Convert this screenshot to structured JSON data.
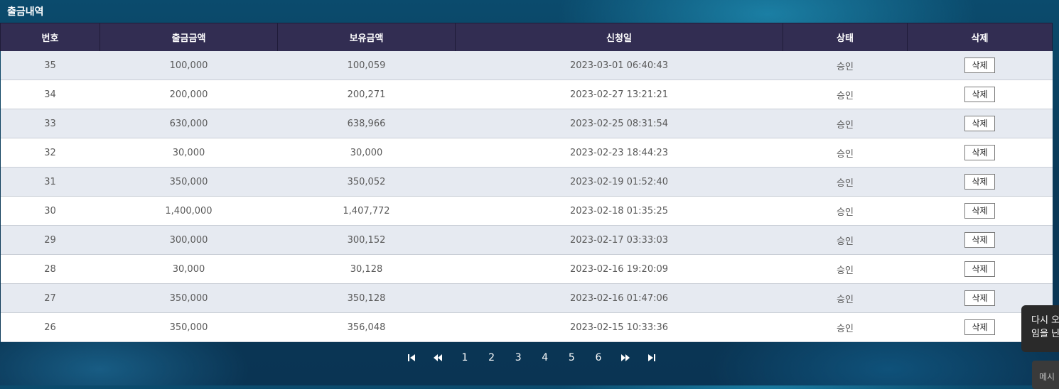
{
  "panel": {
    "title": "출금내역"
  },
  "table": {
    "headers": [
      "번호",
      "출금금액",
      "보유금액",
      "신청일",
      "상태",
      "삭제"
    ],
    "rows": [
      {
        "no": "35",
        "amount": "100,000",
        "balance": "100,059",
        "date": "2023-03-01 06:40:43",
        "status": "승인",
        "action": "삭제"
      },
      {
        "no": "34",
        "amount": "200,000",
        "balance": "200,271",
        "date": "2023-02-27 13:21:21",
        "status": "승인",
        "action": "삭제"
      },
      {
        "no": "33",
        "amount": "630,000",
        "balance": "638,966",
        "date": "2023-02-25 08:31:54",
        "status": "승인",
        "action": "삭제"
      },
      {
        "no": "32",
        "amount": "30,000",
        "balance": "30,000",
        "date": "2023-02-23 18:44:23",
        "status": "승인",
        "action": "삭제"
      },
      {
        "no": "31",
        "amount": "350,000",
        "balance": "350,052",
        "date": "2023-02-19 01:52:40",
        "status": "승인",
        "action": "삭제"
      },
      {
        "no": "30",
        "amount": "1,400,000",
        "balance": "1,407,772",
        "date": "2023-02-18 01:35:25",
        "status": "승인",
        "action": "삭제"
      },
      {
        "no": "29",
        "amount": "300,000",
        "balance": "300,152",
        "date": "2023-02-17 03:33:03",
        "status": "승인",
        "action": "삭제"
      },
      {
        "no": "28",
        "amount": "30,000",
        "balance": "30,128",
        "date": "2023-02-16 19:20:09",
        "status": "승인",
        "action": "삭제"
      },
      {
        "no": "27",
        "amount": "350,000",
        "balance": "350,128",
        "date": "2023-02-16 01:47:06",
        "status": "승인",
        "action": "삭제"
      },
      {
        "no": "26",
        "amount": "350,000",
        "balance": "356,048",
        "date": "2023-02-15 10:33:36",
        "status": "승인",
        "action": "삭제"
      }
    ]
  },
  "pagination": {
    "pages": [
      "1",
      "2",
      "3",
      "4",
      "5",
      "6"
    ],
    "icons": [
      "first-page-icon",
      "previous-page-icon",
      "next-page-icon",
      "last-page-icon"
    ]
  },
  "toast": {
    "line1": "다시 오",
    "line2": "임을 닌"
  },
  "message_tab": {
    "label": "메시"
  },
  "colors": {
    "header_bg": "#322d52",
    "row_alt_bg": "#e6eaf1",
    "row_bg": "#ffffff",
    "page_bg": "#0a3a58"
  }
}
